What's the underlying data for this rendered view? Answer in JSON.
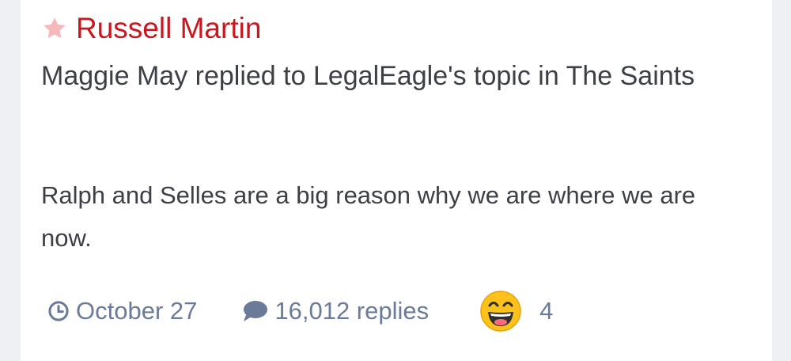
{
  "item": {
    "title": "Russell Martin",
    "title_color": "#c8171f",
    "star_icon": "star-icon",
    "activity_text": "Maggie May replied to LegalEagle's topic in The Saints",
    "snippet": "Ralph and Selles are a big reason why we are where we are now.",
    "meta": {
      "date_icon": "clock-icon",
      "date": "October 27",
      "replies_icon": "comment-icon",
      "replies": "16,012 replies",
      "reaction_icon": "grinning-face-icon",
      "reaction_count": "4"
    }
  }
}
